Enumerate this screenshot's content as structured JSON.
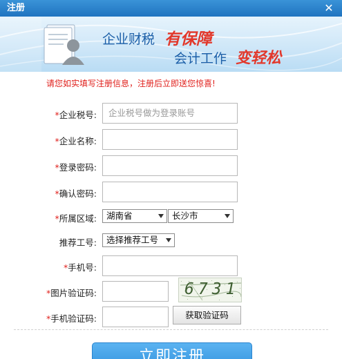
{
  "window": {
    "title": "注册",
    "close_glyph": "✕"
  },
  "banner": {
    "slogan_1": "企业财税",
    "slogan_2": "有保障",
    "slogan_3": "会计工作",
    "slogan_4": "变轻松"
  },
  "notice": "请您如实填写注册信息，注册后立即送您惊喜!",
  "form": {
    "tax_id": {
      "required": "*",
      "label": "企业税号:",
      "placeholder": "企业税号做为登录账号"
    },
    "company_name": {
      "required": "*",
      "label": "企业名称:"
    },
    "password": {
      "required": "*",
      "label": "登录密码:"
    },
    "confirm_password": {
      "required": "*",
      "label": "确认密码:"
    },
    "region": {
      "required": "*",
      "label": "所属区域:",
      "province": "湖南省",
      "city": "长沙市"
    },
    "referrer": {
      "label": "推荐工号:",
      "selected": "选择推荐工号"
    },
    "phone": {
      "required": "*",
      "label": "手机号:"
    },
    "image_code": {
      "required": "*",
      "label": "图片验证码:",
      "captcha_text": "6731"
    },
    "sms_code": {
      "required": "*",
      "label": "手机验证码:",
      "button": "获取验证码"
    }
  },
  "submit": {
    "label": "立即注册"
  },
  "colors": {
    "title_bar": "#2a86cf",
    "required": "#e0201c",
    "accent_red": "#e2382b",
    "accent_blue": "#1c5fa8"
  }
}
